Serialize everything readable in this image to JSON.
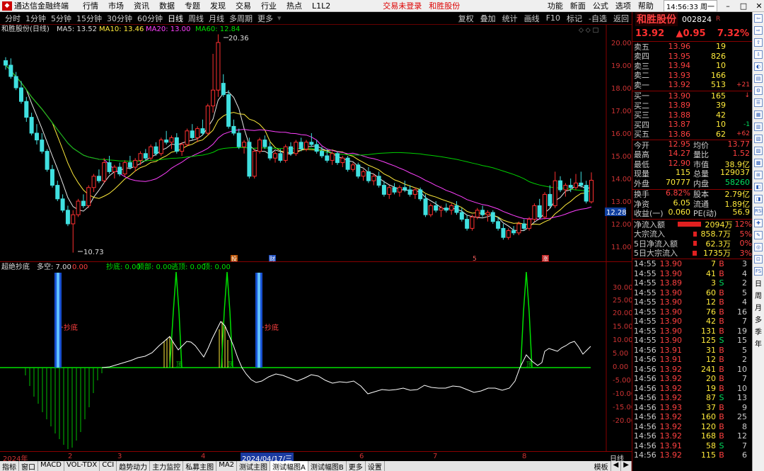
{
  "menu": {
    "app_title": "通达信金融终端",
    "items": [
      "行情",
      "市场",
      "资讯",
      "数据",
      "专题",
      "发现",
      "交易",
      "行业",
      "热点",
      "L1L2"
    ],
    "trade_login": "交易未登录",
    "stock_link": "和胜股份",
    "right_items": [
      "功能",
      "新面",
      "公式",
      "选项",
      "帮助"
    ],
    "clock": "14:56:33 周一"
  },
  "period": {
    "items": [
      "分时",
      "1分钟",
      "5分钟",
      "15分钟",
      "30分钟",
      "60分钟",
      "日线",
      "周线",
      "月线",
      "多周期",
      "更多"
    ],
    "active": "日线",
    "tools": [
      "复权",
      "叠加",
      "统计",
      "画线",
      "F10",
      "标记",
      "-自选",
      "返回"
    ]
  },
  "main_legend": {
    "name": "和胜股份(日线)",
    "ma5": "MA5: 13.52",
    "ma10": "MA10: 13.46",
    "ma20": "MA20: 13.00",
    "ma60": "MA60: 12.84"
  },
  "ind_legend": {
    "name": "超绝抄底",
    "duokong": "多空: 7.00",
    "v1": "0.00",
    "chaodi": "抄底: 0.00",
    "dingbu": "顶部: 0.00",
    "taoding": "逃顶: 0.00",
    "ding": "顶: 0.00"
  },
  "labels": {
    "high": "20.36",
    "low": "10.73",
    "cur_price": "12.28",
    "chaodi1": "抄底",
    "chaodi2": "抄底",
    "ding1": "顶",
    "ding2": "顶",
    "ding3": "顶",
    "ev1": "投",
    "ev2": "财",
    "ev3": "5",
    "ev4": "涨"
  },
  "axes": {
    "main_ticks": [
      "20.00",
      "19.00",
      "18.00",
      "17.00",
      "16.00",
      "15.00",
      "14.00",
      "13.00",
      "12.00",
      "11.00"
    ],
    "ind_ticks": [
      "30.00",
      "25.00",
      "20.00",
      "15.00",
      "10.00",
      "5.00",
      "0.00",
      "-5.00",
      "-10.00",
      "-15.00",
      "-20.00"
    ]
  },
  "dates": [
    "2024年",
    "2",
    "3",
    "4",
    "2024/04/17/三",
    "6",
    "7",
    "8",
    "日线"
  ],
  "bottom_tabs": [
    "指标",
    "窗口",
    "MACD",
    "VOL-TDX",
    "CCI",
    "趋势动力",
    "主力监控",
    "私募主图",
    "MA2",
    "测试主图",
    "测试幅图A",
    "测试幅图B",
    "更多",
    "设置"
  ],
  "bottom_right": [
    "模板",
    "◀",
    "▶"
  ],
  "quote": {
    "name": "和胜股份",
    "code": "002824",
    "r": "R",
    "price": "13.92",
    "change": "▲0.95",
    "pct": "7.32%",
    "asks": [
      [
        "卖五",
        "13.96",
        "19",
        ""
      ],
      [
        "卖四",
        "13.95",
        "826",
        ""
      ],
      [
        "卖三",
        "13.94",
        "10",
        ""
      ],
      [
        "卖二",
        "13.93",
        "166",
        ""
      ],
      [
        "卖一",
        "13.92",
        "513",
        "+21"
      ]
    ],
    "bids": [
      [
        "买一",
        "13.90",
        "165",
        "↓"
      ],
      [
        "买二",
        "13.89",
        "39",
        ""
      ],
      [
        "买三",
        "13.88",
        "42",
        ""
      ],
      [
        "买四",
        "13.87",
        "10",
        "-1"
      ],
      [
        "买五",
        "13.86",
        "62",
        "+62"
      ]
    ],
    "stats": [
      [
        "今开",
        "12.95",
        "均价",
        "13.77"
      ],
      [
        "最高",
        "14.27",
        "量比",
        "1.52"
      ],
      [
        "最低",
        "12.90",
        "市值",
        "38.9亿"
      ],
      [
        "现量",
        "115",
        "总量",
        "129037"
      ],
      [
        "外盘",
        "70777",
        "内盘",
        "58260"
      ]
    ],
    "stats2": [
      [
        "换手",
        "6.82%",
        "股本",
        "2.79亿"
      ],
      [
        "净资",
        "6.05",
        "流通",
        "1.89亿"
      ],
      [
        "收益(一)",
        "0.060",
        "PE(动)",
        "56.9"
      ]
    ],
    "flows": [
      [
        "净流入额",
        "2094万",
        "12%",
        60
      ],
      [
        "大宗流入",
        "858.7万",
        "5%",
        8
      ],
      [
        "5日净流入额",
        "62.3万",
        "0%",
        8
      ],
      [
        "5日大宗流入",
        "1735万",
        "3%",
        10
      ]
    ],
    "ticks": [
      [
        "14:55",
        "13.90",
        "7",
        "B",
        "3"
      ],
      [
        "14:55",
        "13.90",
        "41",
        "B",
        "4"
      ],
      [
        "14:55",
        "13.89",
        "3",
        "S",
        "2"
      ],
      [
        "14:55",
        "13.90",
        "60",
        "B",
        "5"
      ],
      [
        "14:55",
        "13.90",
        "12",
        "B",
        "4"
      ],
      [
        "14:55",
        "13.90",
        "76",
        "B",
        "16"
      ],
      [
        "14:55",
        "13.90",
        "42",
        "B",
        "7"
      ],
      [
        "14:55",
        "13.90",
        "131",
        "B",
        "19"
      ],
      [
        "14:55",
        "13.90",
        "125",
        "S",
        "15"
      ],
      [
        "14:56",
        "13.91",
        "31",
        "B",
        "5"
      ],
      [
        "14:56",
        "13.91",
        "12",
        "B",
        "2"
      ],
      [
        "14:56",
        "13.92",
        "241",
        "B",
        "10"
      ],
      [
        "14:56",
        "13.92",
        "20",
        "B",
        "7"
      ],
      [
        "14:56",
        "13.92",
        "19",
        "B",
        "10"
      ],
      [
        "14:56",
        "13.92",
        "87",
        "S",
        "13"
      ],
      [
        "14:56",
        "13.93",
        "37",
        "B",
        "9"
      ],
      [
        "14:56",
        "13.92",
        "160",
        "B",
        "25"
      ],
      [
        "14:56",
        "13.92",
        "120",
        "B",
        "8"
      ],
      [
        "14:56",
        "13.92",
        "168",
        "B",
        "12"
      ],
      [
        "14:56",
        "13.91",
        "58",
        "S",
        "7"
      ],
      [
        "14:56",
        "13.92",
        "115",
        "B",
        "6"
      ]
    ]
  },
  "sidebar": [
    "⇦",
    "⇨",
    "⇧",
    "⇩",
    "◐",
    "▤",
    "⚙",
    "☰",
    "▦",
    "▥",
    "▧",
    "▨",
    "▩",
    "⊞",
    "◧",
    "◨",
    "RSI",
    "✚",
    "✎",
    "◎",
    "⊡",
    "FS",
    "日",
    "周",
    "月",
    "多",
    "季",
    "年"
  ],
  "candles": [
    [
      19.2,
      19.35,
      18.8,
      19.0
    ],
    [
      19.0,
      19.3,
      18.4,
      18.5
    ],
    [
      18.5,
      18.7,
      17.9,
      18.0
    ],
    [
      18.0,
      18.3,
      17.3,
      17.4
    ],
    [
      17.4,
      17.6,
      16.5,
      16.7
    ],
    [
      16.7,
      16.9,
      15.9,
      16.0
    ],
    [
      16.0,
      16.4,
      15.5,
      15.7
    ],
    [
      15.7,
      16.0,
      15.1,
      15.2
    ],
    [
      15.2,
      15.3,
      14.3,
      14.4
    ],
    [
      14.4,
      14.6,
      13.6,
      13.7
    ],
    [
      13.7,
      13.9,
      13.0,
      13.1
    ],
    [
      13.1,
      13.3,
      12.5,
      12.6
    ],
    [
      12.6,
      12.8,
      11.9,
      12.0
    ],
    [
      12.0,
      12.6,
      10.73,
      12.4
    ],
    [
      12.4,
      13.1,
      12.3,
      13.0
    ],
    [
      13.0,
      13.3,
      12.7,
      12.8
    ],
    [
      12.8,
      13.7,
      12.7,
      13.6
    ],
    [
      13.6,
      14.2,
      13.4,
      14.1
    ],
    [
      14.1,
      14.4,
      13.8,
      13.9
    ],
    [
      13.9,
      14.9,
      13.8,
      14.7
    ],
    [
      14.7,
      15.0,
      14.2,
      14.3
    ],
    [
      14.3,
      14.6,
      14.0,
      14.5
    ],
    [
      14.5,
      14.7,
      14.1,
      14.2
    ],
    [
      14.2,
      14.8,
      14.1,
      14.7
    ],
    [
      14.7,
      15.0,
      14.4,
      14.5
    ],
    [
      14.5,
      14.9,
      14.3,
      14.8
    ],
    [
      14.8,
      15.2,
      14.6,
      15.1
    ],
    [
      15.1,
      15.3,
      14.8,
      14.9
    ],
    [
      14.9,
      15.5,
      14.8,
      15.4
    ],
    [
      15.4,
      15.6,
      15.0,
      15.1
    ],
    [
      15.1,
      15.8,
      15.0,
      15.7
    ],
    [
      15.7,
      16.1,
      15.5,
      15.6
    ],
    [
      15.6,
      15.9,
      15.3,
      15.8
    ],
    [
      15.8,
      16.0,
      15.1,
      15.2
    ],
    [
      15.2,
      15.6,
      15.0,
      15.5
    ],
    [
      15.5,
      16.2,
      15.4,
      16.1
    ],
    [
      16.1,
      16.4,
      15.7,
      15.8
    ],
    [
      15.8,
      16.3,
      15.6,
      16.2
    ],
    [
      16.2,
      16.6,
      15.9,
      16.0
    ],
    [
      16.0,
      17.3,
      15.9,
      17.2
    ],
    [
      17.2,
      19.5,
      16.9,
      17.9
    ],
    [
      17.9,
      20.36,
      17.6,
      20.0
    ],
    [
      18.2,
      18.6,
      17.6,
      17.7
    ],
    [
      17.7,
      17.9,
      16.2,
      16.3
    ],
    [
      16.3,
      16.6,
      15.9,
      16.0
    ],
    [
      16.0,
      16.2,
      15.3,
      15.4
    ],
    [
      15.4,
      15.7,
      15.1,
      15.6
    ],
    [
      15.6,
      15.8,
      14.0,
      14.1
    ],
    [
      14.1,
      15.3,
      14.0,
      15.2
    ],
    [
      15.2,
      15.8,
      15.1,
      15.7
    ],
    [
      15.7,
      15.9,
      15.3,
      15.4
    ],
    [
      15.4,
      15.6,
      14.8,
      14.9
    ],
    [
      14.9,
      15.2,
      14.7,
      15.1
    ],
    [
      15.1,
      15.3,
      14.7,
      14.8
    ],
    [
      14.8,
      15.5,
      14.7,
      15.4
    ],
    [
      15.4,
      15.6,
      15.0,
      15.1
    ],
    [
      15.1,
      15.7,
      15.0,
      15.6
    ],
    [
      15.6,
      15.8,
      15.2,
      15.3
    ],
    [
      15.3,
      15.7,
      15.2,
      15.6
    ],
    [
      15.6,
      16.0,
      15.4,
      15.5
    ],
    [
      15.5,
      15.7,
      15.1,
      15.2
    ],
    [
      15.2,
      15.4,
      14.9,
      15.0
    ],
    [
      15.0,
      15.3,
      14.7,
      14.8
    ],
    [
      14.8,
      15.2,
      14.6,
      15.1
    ],
    [
      15.1,
      15.2,
      14.6,
      14.7
    ],
    [
      14.7,
      15.0,
      14.5,
      14.9
    ],
    [
      14.9,
      15.0,
      14.3,
      14.4
    ],
    [
      14.4,
      14.7,
      14.3,
      14.6
    ],
    [
      14.6,
      14.7,
      14.0,
      14.1
    ],
    [
      14.1,
      14.4,
      13.9,
      14.3
    ],
    [
      14.3,
      14.5,
      13.8,
      13.9
    ],
    [
      13.9,
      14.2,
      13.7,
      14.1
    ],
    [
      14.1,
      14.3,
      13.6,
      13.7
    ],
    [
      13.7,
      13.9,
      13.2,
      13.3
    ],
    [
      13.3,
      13.7,
      13.1,
      13.6
    ],
    [
      13.6,
      13.8,
      13.3,
      13.4
    ],
    [
      13.4,
      13.7,
      13.2,
      13.6
    ],
    [
      13.6,
      13.9,
      13.4,
      13.5
    ],
    [
      13.5,
      13.7,
      13.2,
      13.3
    ],
    [
      13.3,
      13.6,
      13.1,
      13.5
    ],
    [
      13.5,
      13.6,
      13.0,
      13.1
    ],
    [
      13.1,
      13.3,
      12.3,
      12.4
    ],
    [
      12.4,
      12.9,
      12.3,
      12.8
    ],
    [
      12.8,
      13.0,
      12.5,
      12.6
    ],
    [
      12.6,
      12.8,
      12.3,
      12.7
    ],
    [
      12.7,
      12.9,
      12.5,
      12.6
    ],
    [
      12.6,
      12.9,
      12.4,
      12.8
    ],
    [
      12.8,
      13.0,
      12.4,
      12.5
    ],
    [
      12.5,
      12.7,
      12.1,
      12.2
    ],
    [
      12.2,
      12.4,
      11.7,
      11.8
    ],
    [
      11.8,
      12.4,
      11.7,
      12.3
    ],
    [
      12.3,
      12.7,
      12.2,
      12.6
    ],
    [
      12.6,
      12.8,
      12.3,
      12.4
    ],
    [
      12.4,
      12.6,
      12.1,
      12.5
    ],
    [
      12.5,
      12.6,
      12.0,
      12.1
    ],
    [
      12.1,
      12.3,
      11.7,
      11.8
    ],
    [
      11.8,
      12.0,
      11.3,
      11.4
    ],
    [
      11.4,
      11.8,
      11.3,
      11.7
    ],
    [
      11.7,
      11.9,
      11.5,
      11.6
    ],
    [
      11.6,
      12.1,
      11.5,
      12.0
    ],
    [
      12.0,
      12.2,
      11.7,
      11.8
    ],
    [
      11.8,
      12.3,
      11.7,
      12.2
    ],
    [
      12.2,
      12.9,
      12.1,
      12.8
    ],
    [
      12.8,
      13.1,
      12.2,
      12.3
    ],
    [
      12.3,
      13.4,
      12.2,
      13.3
    ],
    [
      13.3,
      13.7,
      12.7,
      12.8
    ],
    [
      12.8,
      14.3,
      12.7,
      13.9
    ],
    [
      13.9,
      14.1,
      13.4,
      13.5
    ],
    [
      13.5,
      13.8,
      13.2,
      13.7
    ],
    [
      13.7,
      14.0,
      13.4,
      13.6
    ],
    [
      13.6,
      14.2,
      13.5,
      13.8
    ],
    [
      13.8,
      14.3,
      13.6,
      13.7
    ],
    [
      13.7,
      13.9,
      12.9,
      13.0
    ],
    [
      12.97,
      14.27,
      12.9,
      13.92
    ]
  ]
}
